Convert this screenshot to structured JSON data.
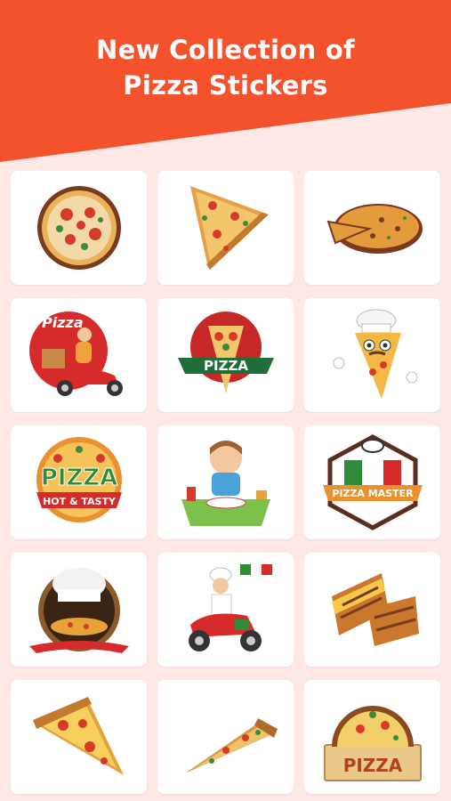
{
  "header": {
    "title_line1": "New Collection of",
    "title_line2": "Pizza Stickers",
    "accent_color": "#f4522c",
    "background_color": "#fde8e6"
  },
  "stickers": [
    {
      "name": "round-pizza-sticker",
      "text": ""
    },
    {
      "name": "pizza-slice-sticker",
      "text": ""
    },
    {
      "name": "pizza-with-slice-out-sticker",
      "text": ""
    },
    {
      "name": "pizza-delivery-scooter-sticker",
      "text": "Pizza"
    },
    {
      "name": "pizza-badge-sticker",
      "text": "PIZZA"
    },
    {
      "name": "chef-pizza-character-sticker",
      "text": ""
    },
    {
      "name": "pizza-hot-tasty-sticker",
      "text": "PIZZA",
      "text2": "HOT & TASTY"
    },
    {
      "name": "kid-eating-sticker",
      "text": ""
    },
    {
      "name": "pizza-master-sticker",
      "text": "PIZZA MASTER"
    },
    {
      "name": "chef-hat-pizza-sticker",
      "text": ""
    },
    {
      "name": "chef-on-scooter-sticker",
      "text": ""
    },
    {
      "name": "grilled-sandwich-sticker",
      "text": ""
    },
    {
      "name": "cheesy-slice-sticker",
      "text": ""
    },
    {
      "name": "thin-slice-sticker",
      "text": ""
    },
    {
      "name": "pizza-box-sticker",
      "text": "PIZZA"
    }
  ]
}
